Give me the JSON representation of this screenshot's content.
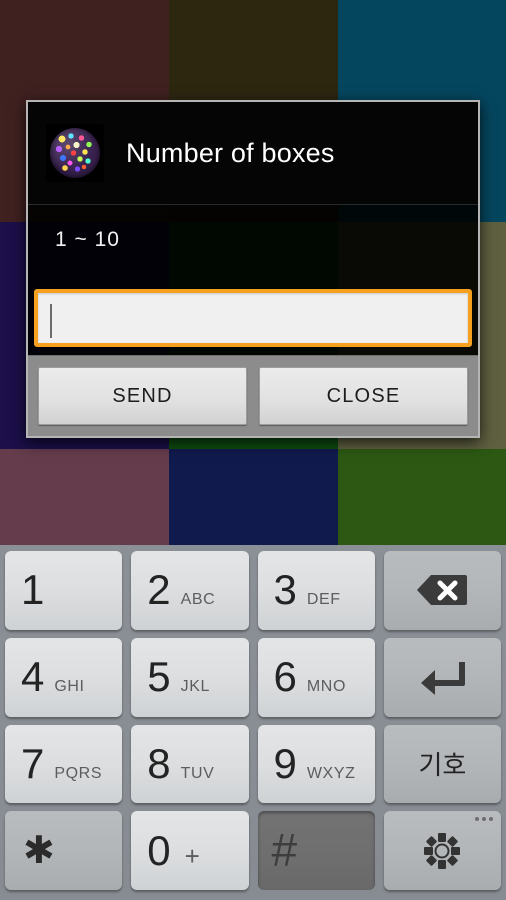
{
  "background": {
    "description": "color-block wallpaper behind dialog",
    "cells": [
      {
        "name": "bg-cell-top-left",
        "color": "#3f2120"
      },
      {
        "name": "bg-cell-top-center",
        "color": "#2d2710"
      },
      {
        "name": "bg-cell-top-right",
        "color": "#05465f"
      },
      {
        "name": "bg-cell-mid-left",
        "color": "#1c0f4a"
      },
      {
        "name": "bg-cell-mid-center",
        "color": "#0e4d10"
      },
      {
        "name": "bg-cell-mid-right",
        "color": "#5f6040"
      },
      {
        "name": "bg-cell-bot-left",
        "color": "#643c4c"
      },
      {
        "name": "bg-cell-bot-center",
        "color": "#101a4c"
      },
      {
        "name": "bg-cell-bot-right",
        "color": "#2c5813"
      }
    ]
  },
  "dialog": {
    "title": "Number of boxes",
    "icon": "mosaic-ball-icon",
    "message": "1 ~ 10",
    "input": {
      "value": "",
      "placeholder": "",
      "focused": true,
      "focus_color": "#f5a01e"
    },
    "buttons": [
      {
        "name": "send-button",
        "label": "SEND"
      },
      {
        "name": "close-button",
        "label": "CLOSE"
      }
    ]
  },
  "keyboard": {
    "type": "numeric-keypad",
    "background_color": "#888d93",
    "keys": [
      {
        "name": "key-1",
        "digit": "1",
        "letters": "",
        "style": "light",
        "kind": "digit"
      },
      {
        "name": "key-2",
        "digit": "2",
        "letters": "ABC",
        "style": "light",
        "kind": "digit"
      },
      {
        "name": "key-3",
        "digit": "3",
        "letters": "DEF",
        "style": "light",
        "kind": "digit"
      },
      {
        "name": "key-backspace",
        "digit": "",
        "letters": "",
        "style": "dark",
        "kind": "backspace",
        "icon": "backspace-icon"
      },
      {
        "name": "key-4",
        "digit": "4",
        "letters": "GHI",
        "style": "light",
        "kind": "digit"
      },
      {
        "name": "key-5",
        "digit": "5",
        "letters": "JKL",
        "style": "light",
        "kind": "digit"
      },
      {
        "name": "key-6",
        "digit": "6",
        "letters": "MNO",
        "style": "light",
        "kind": "digit"
      },
      {
        "name": "key-enter",
        "digit": "",
        "letters": "",
        "style": "dark",
        "kind": "enter",
        "icon": "enter-return-icon"
      },
      {
        "name": "key-7",
        "digit": "7",
        "letters": "PQRS",
        "style": "light",
        "kind": "digit"
      },
      {
        "name": "key-8",
        "digit": "8",
        "letters": "TUV",
        "style": "light",
        "kind": "digit"
      },
      {
        "name": "key-9",
        "digit": "9",
        "letters": "WXYZ",
        "style": "light",
        "kind": "digit"
      },
      {
        "name": "key-symbol",
        "digit": "",
        "letters": "",
        "style": "dark",
        "kind": "hangul",
        "label": "기호"
      },
      {
        "name": "key-asterisk",
        "digit": "",
        "letters": "",
        "style": "dark",
        "kind": "star",
        "label": "✱"
      },
      {
        "name": "key-0",
        "digit": "0",
        "letters": "+",
        "style": "light",
        "kind": "zero"
      },
      {
        "name": "key-hash",
        "digit": "",
        "letters": "",
        "style": "pressed",
        "kind": "hash",
        "label": "#"
      },
      {
        "name": "key-settings",
        "digit": "",
        "letters": "",
        "style": "dark",
        "kind": "settings",
        "icon": "gear-icon"
      }
    ]
  }
}
